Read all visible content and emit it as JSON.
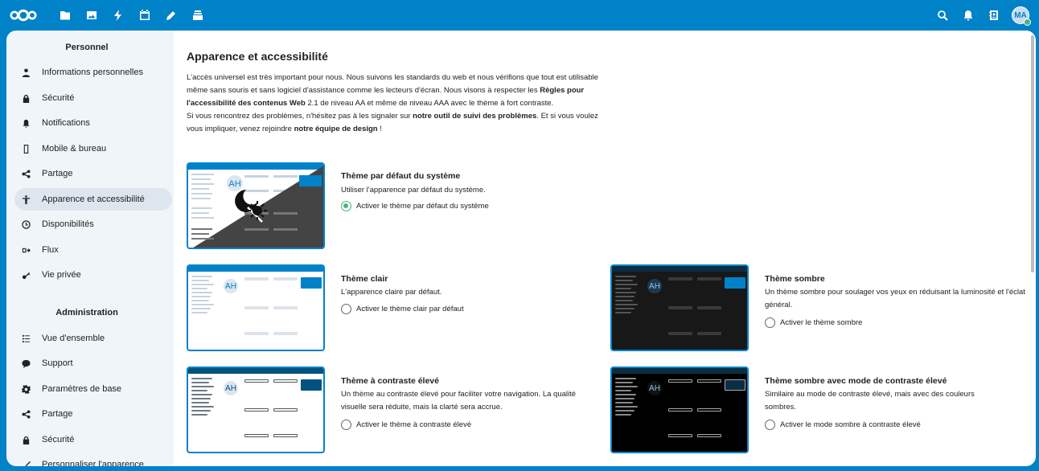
{
  "header": {
    "apps": [
      "files-icon",
      "photos-icon",
      "activity-icon",
      "calendar-icon",
      "notes-icon",
      "deck-icon"
    ],
    "right": [
      "search-icon",
      "notifications-icon",
      "contacts-icon"
    ],
    "avatar_initials": "MA"
  },
  "sidebar": {
    "personal_title": "Personnel",
    "personal_items": [
      {
        "label": "Informations personnelles",
        "icon": "person-icon"
      },
      {
        "label": "Sécurité",
        "icon": "lock-icon"
      },
      {
        "label": "Notifications",
        "icon": "bell-icon"
      },
      {
        "label": "Mobile & bureau",
        "icon": "phone-icon"
      },
      {
        "label": "Partage",
        "icon": "share-icon"
      },
      {
        "label": "Apparence et accessibilité",
        "icon": "accessibility-icon",
        "active": true
      },
      {
        "label": "Disponibilités",
        "icon": "clock-icon"
      },
      {
        "label": "Flux",
        "icon": "flow-icon"
      },
      {
        "label": "Vie privée",
        "icon": "key-icon"
      }
    ],
    "admin_title": "Administration",
    "admin_items": [
      {
        "label": "Vue d'ensemble",
        "icon": "list-icon"
      },
      {
        "label": "Support",
        "icon": "chat-icon"
      },
      {
        "label": "Paramètres de base",
        "icon": "gear-icon"
      },
      {
        "label": "Partage",
        "icon": "share-icon"
      },
      {
        "label": "Sécurité",
        "icon": "lock-icon"
      },
      {
        "label": "Personnaliser l'apparence",
        "icon": "brush-icon"
      }
    ]
  },
  "main": {
    "title": "Apparence et accessibilité",
    "intro": {
      "p1a": "L'accès universel est très important pour nous. Nous suivons les standards du web et nous vérifions que tout est utilisable même sans souris et sans logiciel d'assistance comme les lecteurs d'écran. Nous visons à respecter les ",
      "p1link": "Règles pour l'accessibilité des contenus Web",
      "p1b": " 2.1 de niveau AA et même de niveau AAA avec le thème à fort contraste.",
      "p2a": "Si vous rencontrez des problèmes, n'hésitez pas à les signaler sur ",
      "p2link1": "notre outil de suivi des problèmes",
      "p2b": ". Et si vous voulez vous impliquer, venez rejoindre ",
      "p2link2": "notre équipe de design",
      "p2c": " !"
    },
    "themes": {
      "default": {
        "title": "Thème par défaut du système",
        "desc": "Utiliser l'apparence par défaut du système.",
        "radio": "Activer le thème par défaut du système",
        "checked": true
      },
      "light": {
        "title": "Thème clair",
        "desc": "L'apparence claire par défaut.",
        "radio": "Activer le thème clair par défaut",
        "checked": false
      },
      "dark": {
        "title": "Thème sombre",
        "desc": "Un thème sombre pour soulager vos yeux en réduisant la luminosité et l'éclat général.",
        "radio": "Activer le thème sombre",
        "checked": false
      },
      "contrast": {
        "title": "Thème à contraste élevé",
        "desc": "Un thème au contraste élevé pour faciliter votre navigation. La qualité visuelle sera réduite, mais la clarté sera accrue.",
        "radio": "Activer le thème à contraste élevé",
        "checked": false
      },
      "dark_contrast": {
        "title": "Thème sombre avec mode de contraste élevé",
        "desc": "Similaire au mode de contraste élevé, mais avec des couleurs sombres.",
        "radio": "Activer le mode sombre à contraste élevé",
        "checked": false
      }
    },
    "preview_avatar": "AH"
  },
  "colors": {
    "primary": "#0082c9",
    "active_radio": "#49b382",
    "sidebar_bg": "#f0f5fa"
  }
}
